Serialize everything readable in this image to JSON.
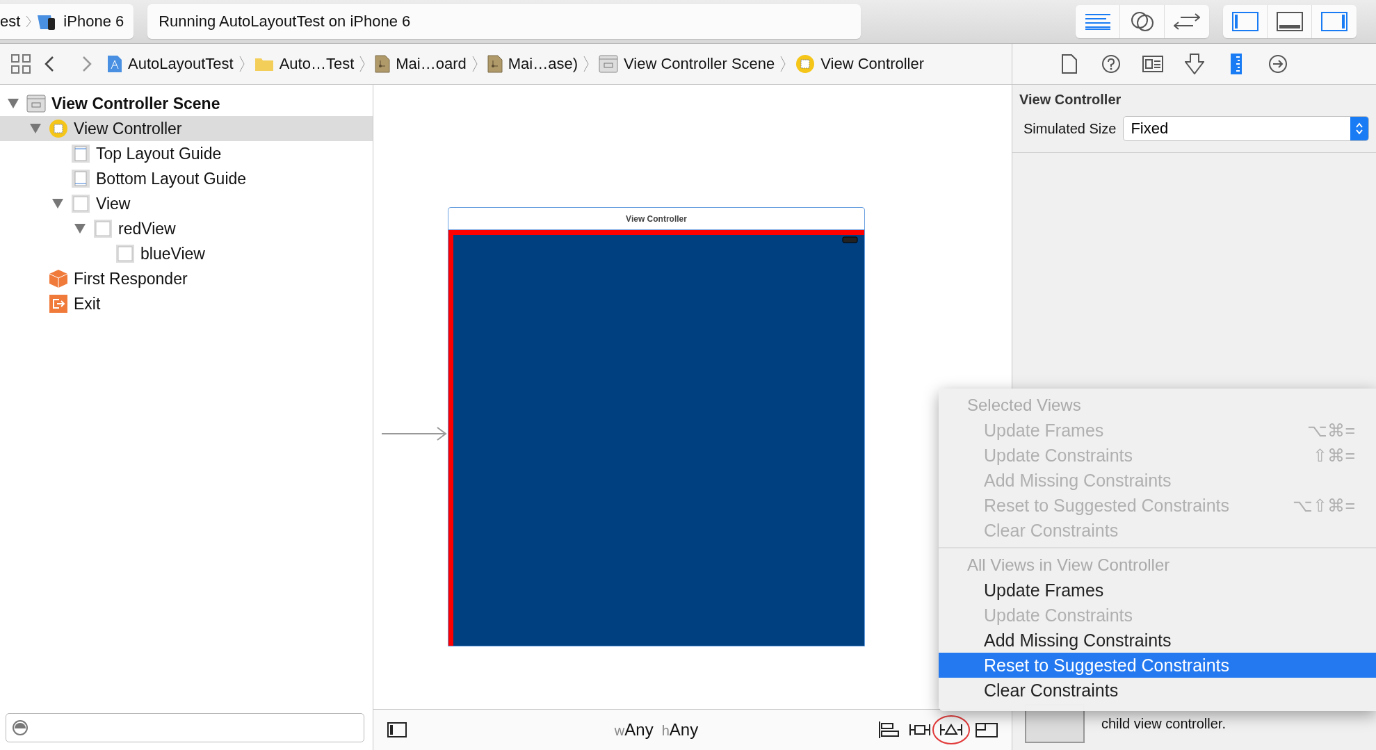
{
  "toolbar": {
    "scheme": {
      "target_partial": "est",
      "device": "iPhone 6"
    },
    "activity": "Running AutoLayoutTest on iPhone 6",
    "editor_buttons": [
      {
        "kind": "standard",
        "selected": true
      },
      {
        "kind": "assistant",
        "selected": false
      },
      {
        "kind": "version",
        "selected": false
      }
    ],
    "panel_toggles": [
      {
        "kind": "navigator",
        "on": true
      },
      {
        "kind": "debug",
        "on": false
      },
      {
        "kind": "utilities",
        "on": true
      }
    ]
  },
  "jump_bar": [
    {
      "kind": "project",
      "label": "AutoLayoutTest"
    },
    {
      "kind": "folder",
      "label": "Auto…Test"
    },
    {
      "kind": "storyboard",
      "label": "Mai…oard"
    },
    {
      "kind": "storyboard",
      "label": "Mai…ase)"
    },
    {
      "kind": "scene",
      "label": "View Controller Scene"
    },
    {
      "kind": "controller",
      "label": "View Controller"
    }
  ],
  "outline": [
    {
      "kind": "scene",
      "label": "View Controller Scene",
      "expanded": true,
      "selected": false,
      "children": [
        {
          "kind": "controller",
          "label": "View Controller",
          "expanded": true,
          "selected": true,
          "children": [
            {
              "kind": "top-guide",
              "label": "Top Layout Guide",
              "selected": false
            },
            {
              "kind": "bottom-guide",
              "label": "Bottom Layout Guide",
              "selected": false
            },
            {
              "kind": "view",
              "label": "View",
              "expanded": true,
              "selected": false,
              "children": [
                {
                  "kind": "view",
                  "label": "redView",
                  "expanded": true,
                  "selected": false,
                  "children": [
                    {
                      "kind": "view",
                      "label": "blueView",
                      "selected": false
                    }
                  ]
                }
              ]
            }
          ]
        },
        {
          "kind": "responder",
          "label": "First Responder",
          "selected": false
        },
        {
          "kind": "exit",
          "label": "Exit",
          "selected": false
        }
      ]
    }
  ],
  "canvas": {
    "scene_title": "View Controller",
    "size_class": {
      "w_label": "w",
      "w_value": "Any",
      "h_label": "h",
      "h_value": "Any"
    }
  },
  "inspector": {
    "tabs": [
      {
        "kind": "file",
        "selected": false
      },
      {
        "kind": "help",
        "selected": false
      },
      {
        "kind": "identity",
        "selected": false
      },
      {
        "kind": "attributes",
        "selected": false
      },
      {
        "kind": "size",
        "selected": true
      },
      {
        "kind": "connections",
        "selected": false
      }
    ],
    "title": "View Controller",
    "simulated_size": {
      "label": "Simulated Size",
      "value": "Fixed"
    },
    "library_text": "child view controller."
  },
  "menu": {
    "sections": [
      {
        "title": "Selected Views",
        "items": [
          {
            "label": "Update Frames",
            "shortcut": "⌥⌘=",
            "disabled": true,
            "selected": false
          },
          {
            "label": "Update Constraints",
            "shortcut": "⇧⌘=",
            "disabled": true,
            "selected": false
          },
          {
            "label": "Add Missing Constraints",
            "disabled": true,
            "selected": false
          },
          {
            "label": "Reset to Suggested Constraints",
            "shortcut": "⌥⇧⌘=",
            "disabled": true,
            "selected": false
          },
          {
            "label": "Clear Constraints",
            "disabled": true,
            "selected": false
          }
        ]
      },
      {
        "title": "All Views in View Controller",
        "items": [
          {
            "label": "Update Frames",
            "disabled": false,
            "selected": false
          },
          {
            "label": "Update Constraints",
            "disabled": true,
            "selected": false
          },
          {
            "label": "Add Missing Constraints",
            "disabled": false,
            "selected": false
          },
          {
            "label": "Reset to Suggested Constraints",
            "disabled": false,
            "selected": true
          },
          {
            "label": "Clear Constraints",
            "disabled": false,
            "selected": false
          }
        ]
      }
    ]
  }
}
